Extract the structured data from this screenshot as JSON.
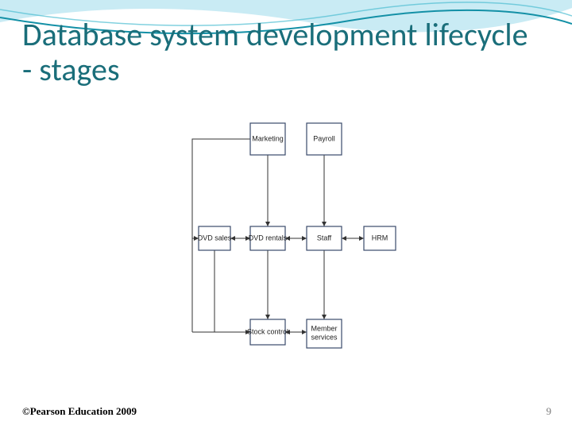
{
  "title": "Database system development lifecycle - stages",
  "footer": {
    "copyright": "©Pearson Education 2009",
    "page": "9"
  },
  "boxes": {
    "marketing": "Marketing",
    "payroll": "Payroll",
    "dvd_sales": "DVD sales",
    "dvd_rentals": "DVD rentals",
    "staff": "Staff",
    "hrm": "HRM",
    "stock_control": "Stock control",
    "member_services_l1": "Member",
    "member_services_l2": "services"
  },
  "icons": {
    "header_wave": "wave-header-icon",
    "arrowhead": "arrowhead-icon"
  }
}
